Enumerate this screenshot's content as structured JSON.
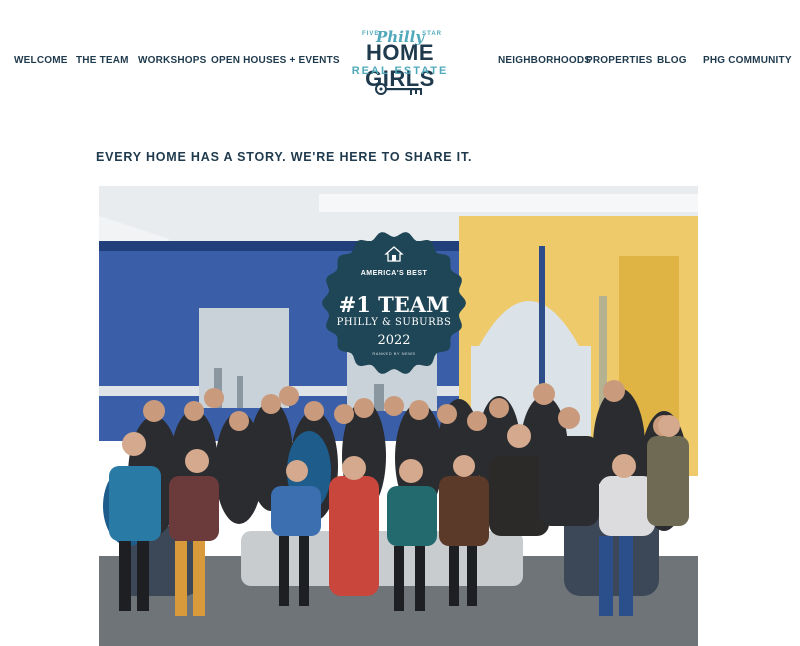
{
  "nav_left": [
    {
      "label": "WELCOME"
    },
    {
      "label": "THE TEAM"
    },
    {
      "label": "WORKSHOPS"
    },
    {
      "label": "OPEN HOUSES + EVENTS"
    }
  ],
  "nav_right": [
    {
      "label": "NEIGHBORHOODS"
    },
    {
      "label": "PROPERTIES"
    },
    {
      "label": "BLOG"
    },
    {
      "label": "PHG COMMUNITY"
    }
  ],
  "logo": {
    "five": "FIVE",
    "philly": "Philly",
    "star": "STAR",
    "main": "HOME GIRLS",
    "sub": "REAL ESTATE",
    "icon": "key-icon"
  },
  "tagline": "EVERY HOME HAS A STORY. WE'RE HERE TO SHARE IT.",
  "badge": {
    "brand": "AMERICA'S BEST",
    "title": "#1 TEAM",
    "subtitle": "PHILLY & SUBURBS",
    "year": "2022",
    "ranked": "RANKED BY NEWS",
    "icon": "house-icon"
  },
  "colors": {
    "navy": "#1f3a4d",
    "teal": "#4fa9ba",
    "badge": "#1f4656",
    "wall_blue": "#3a5fa8",
    "wall_yellow": "#f1c24a"
  }
}
